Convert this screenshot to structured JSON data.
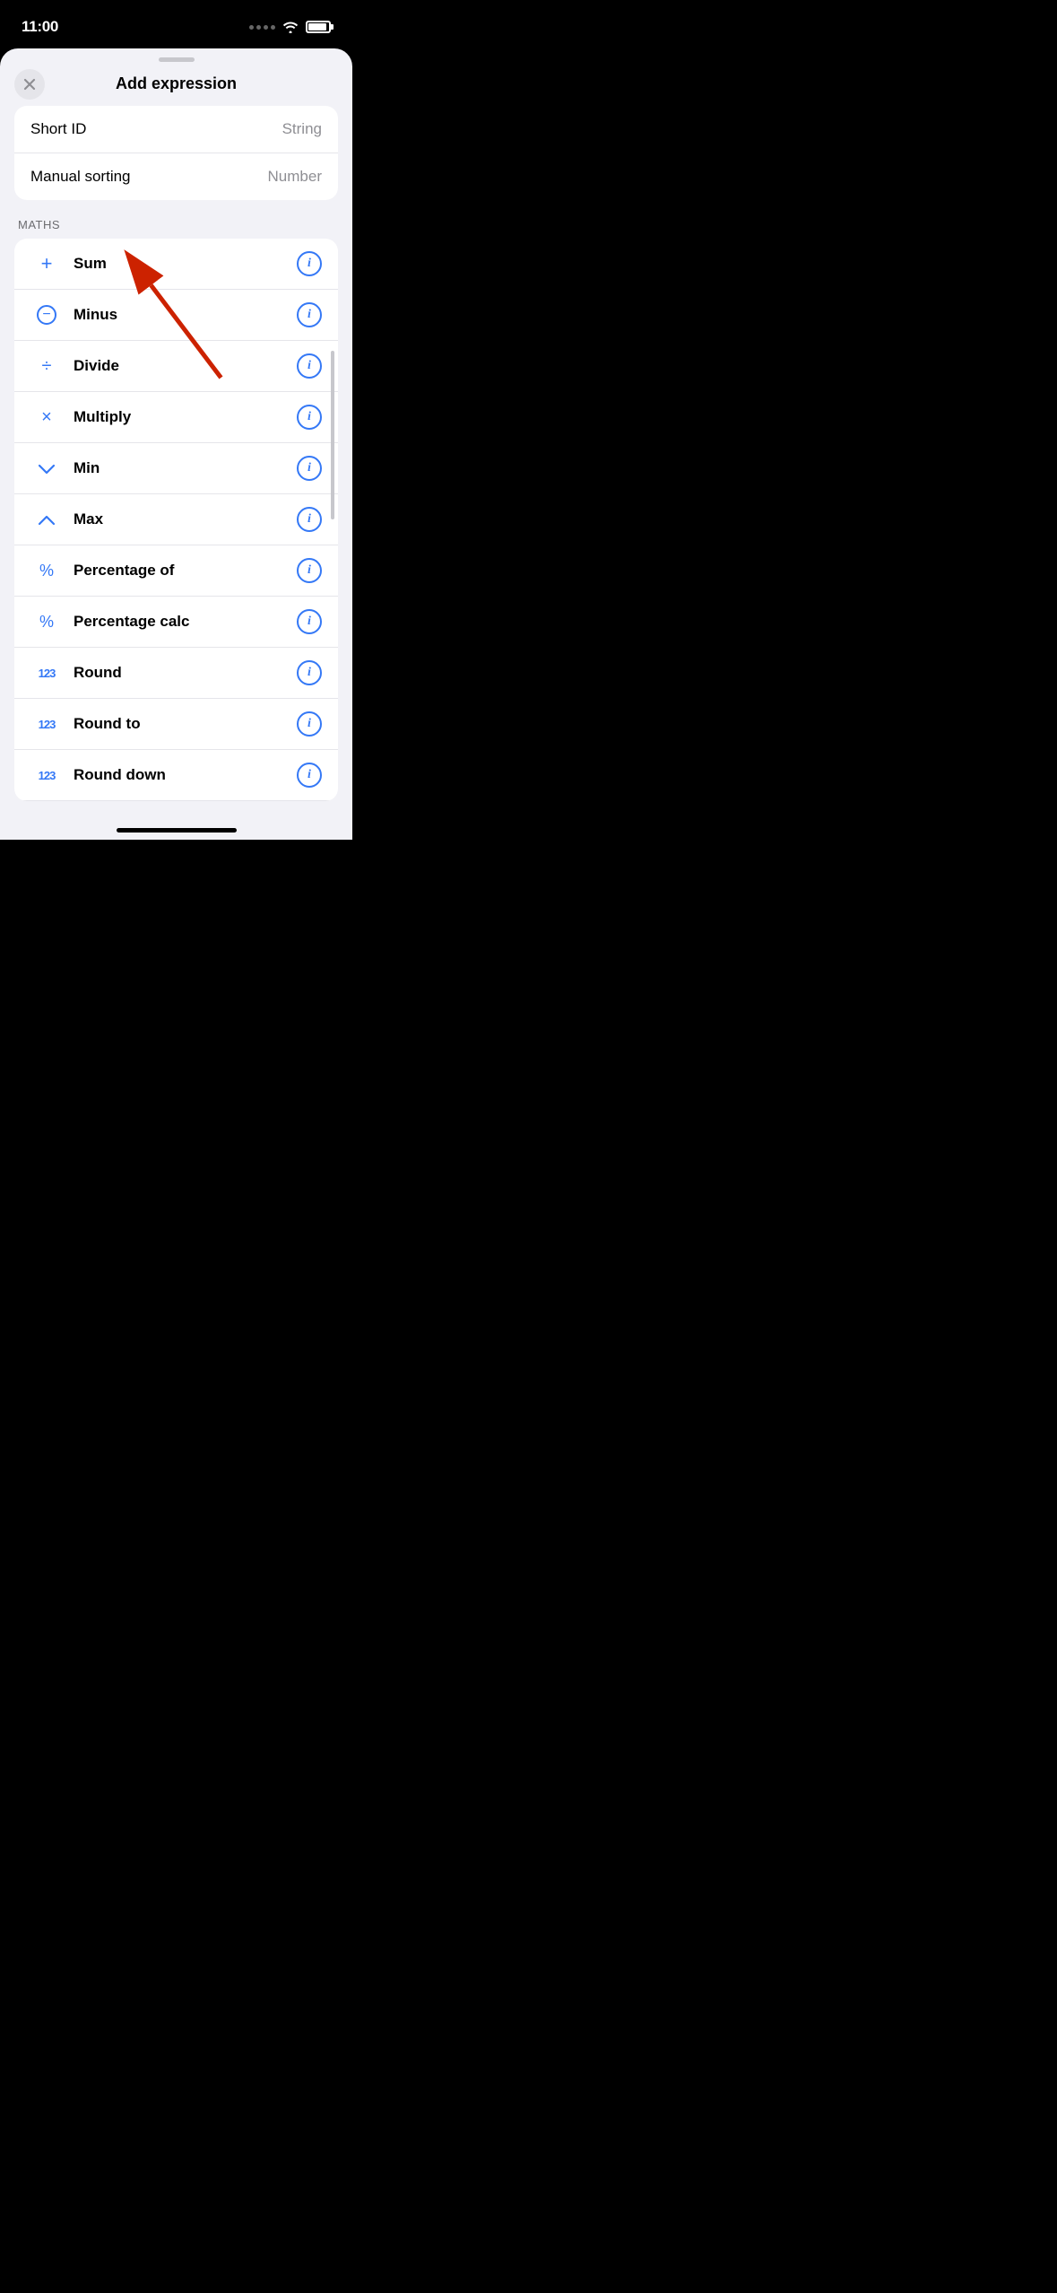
{
  "statusBar": {
    "time": "11:00"
  },
  "header": {
    "title": "Add expression",
    "closeLabel": "×"
  },
  "topItems": [
    {
      "label": "Short ID",
      "type": "String"
    },
    {
      "label": "Manual sorting",
      "type": "Number"
    }
  ],
  "mathsSection": {
    "heading": "MATHS",
    "items": [
      {
        "id": "sum",
        "icon": "+",
        "iconType": "text",
        "label": "Sum"
      },
      {
        "id": "minus",
        "icon": "minus-circle",
        "iconType": "circle-minus",
        "label": "Minus"
      },
      {
        "id": "divide",
        "icon": "÷",
        "iconType": "text",
        "label": "Divide"
      },
      {
        "id": "multiply",
        "icon": "×",
        "iconType": "text",
        "label": "Multiply"
      },
      {
        "id": "min",
        "icon": "∨",
        "iconType": "text",
        "label": "Min"
      },
      {
        "id": "max",
        "icon": "∧",
        "iconType": "text",
        "label": "Max"
      },
      {
        "id": "percentage-of",
        "icon": "%",
        "iconType": "text",
        "label": "Percentage of"
      },
      {
        "id": "percentage-calc",
        "icon": "%",
        "iconType": "text",
        "label": "Percentage calc"
      },
      {
        "id": "round",
        "icon": "123",
        "iconType": "text-small",
        "label": "Round"
      },
      {
        "id": "round-to",
        "icon": "123",
        "iconType": "text-small",
        "label": "Round to"
      },
      {
        "id": "round-down",
        "icon": "123",
        "iconType": "text-small",
        "label": "Round down"
      }
    ],
    "infoButtonLabel": "i"
  },
  "homeIndicator": {}
}
